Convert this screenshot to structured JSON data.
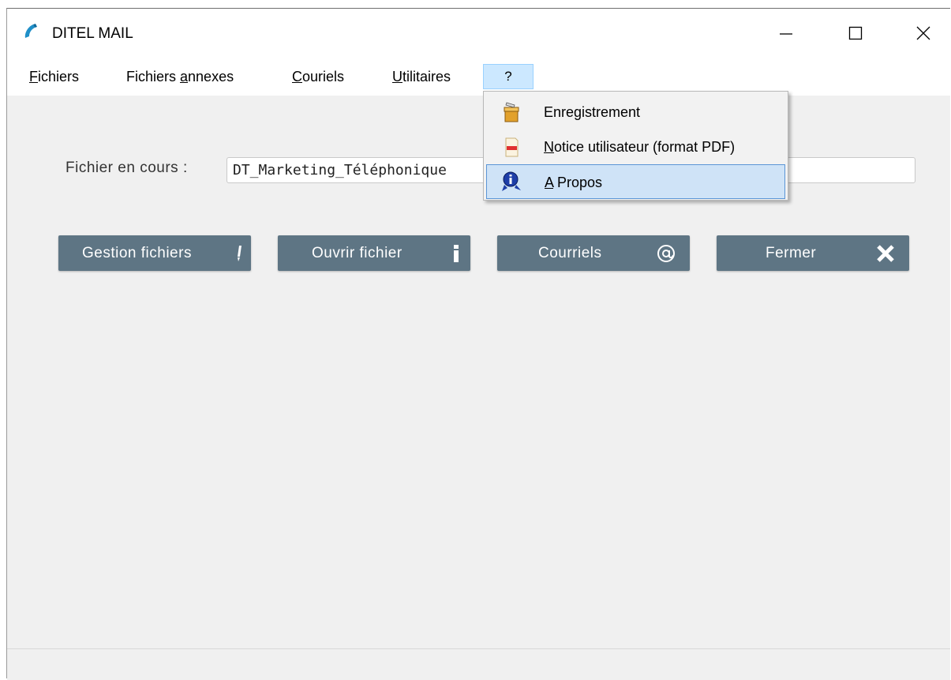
{
  "window": {
    "title": "DITEL MAIL"
  },
  "menubar": {
    "items": [
      {
        "mnemonic": "F",
        "rest": "ichiers"
      },
      {
        "pre": "Fichiers ",
        "mnemonic": "a",
        "rest": "nnexes"
      },
      {
        "mnemonic": "C",
        "rest": "ouriels"
      },
      {
        "mnemonic": "U",
        "rest": "tilitaires"
      },
      {
        "label": "?"
      }
    ]
  },
  "dropdown": {
    "items": [
      {
        "label": "Enregistrement",
        "icon": "registration-icon"
      },
      {
        "mnemonic": "N",
        "rest": "otice utilisateur (format PDF)",
        "icon": "pdf-icon"
      },
      {
        "mnemonic": "A",
        "rest": " Propos",
        "icon": "about-icon"
      }
    ]
  },
  "main": {
    "current_file_label": "Fichier en cours :",
    "current_file_value": "DT_Marketing_Téléphonique",
    "buttons": [
      {
        "label": "Gestion fichiers",
        "icon": "pencil-icon"
      },
      {
        "label": "Ouvrir fichier",
        "icon": "info-icon"
      },
      {
        "label": "Courriels",
        "icon": "at-sign-icon"
      },
      {
        "label": "Fermer",
        "icon": "close-x-icon"
      }
    ]
  },
  "colors": {
    "button_bg": "#5e7584",
    "menu_highlight": "#cce8ff",
    "dropdown_highlight": "#cfe3f7"
  }
}
